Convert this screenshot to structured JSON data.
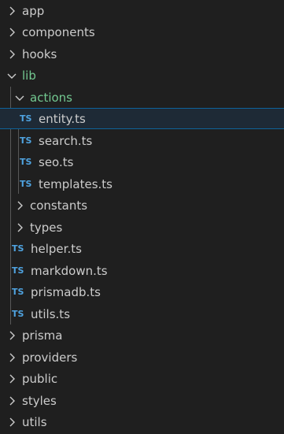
{
  "explorer": {
    "items": [
      {
        "label": "app",
        "type": "folder",
        "state": "collapsed"
      },
      {
        "label": "components",
        "type": "folder",
        "state": "collapsed"
      },
      {
        "label": "hooks",
        "type": "folder",
        "state": "collapsed"
      },
      {
        "label": "lib",
        "type": "folder",
        "state": "expanded",
        "color": "#73c991"
      },
      {
        "label": "actions",
        "type": "folder",
        "state": "expanded",
        "color": "#73c991"
      },
      {
        "label": "entity.ts",
        "type": "file",
        "icon": "TS",
        "selected": true
      },
      {
        "label": "search.ts",
        "type": "file",
        "icon": "TS"
      },
      {
        "label": "seo.ts",
        "type": "file",
        "icon": "TS"
      },
      {
        "label": "templates.ts",
        "type": "file",
        "icon": "TS"
      },
      {
        "label": "constants",
        "type": "folder",
        "state": "collapsed"
      },
      {
        "label": "types",
        "type": "folder",
        "state": "collapsed"
      },
      {
        "label": "helper.ts",
        "type": "file",
        "icon": "TS"
      },
      {
        "label": "markdown.ts",
        "type": "file",
        "icon": "TS"
      },
      {
        "label": "prismadb.ts",
        "type": "file",
        "icon": "TS"
      },
      {
        "label": "utils.ts",
        "type": "file",
        "icon": "TS"
      },
      {
        "label": "prisma",
        "type": "folder",
        "state": "collapsed"
      },
      {
        "label": "providers",
        "type": "folder",
        "state": "collapsed"
      },
      {
        "label": "public",
        "type": "folder",
        "state": "collapsed"
      },
      {
        "label": "styles",
        "type": "folder",
        "state": "collapsed"
      },
      {
        "label": "utils",
        "type": "folder",
        "state": "collapsed"
      }
    ]
  },
  "colors": {
    "background": "#1f1f1f",
    "text": "#cccccc",
    "modified_folder": "#73c991",
    "ts_icon": "#4fa3e0",
    "selection_border": "#0e639c",
    "selection_background": "#1e2a36",
    "indent_guide": "#585858"
  }
}
